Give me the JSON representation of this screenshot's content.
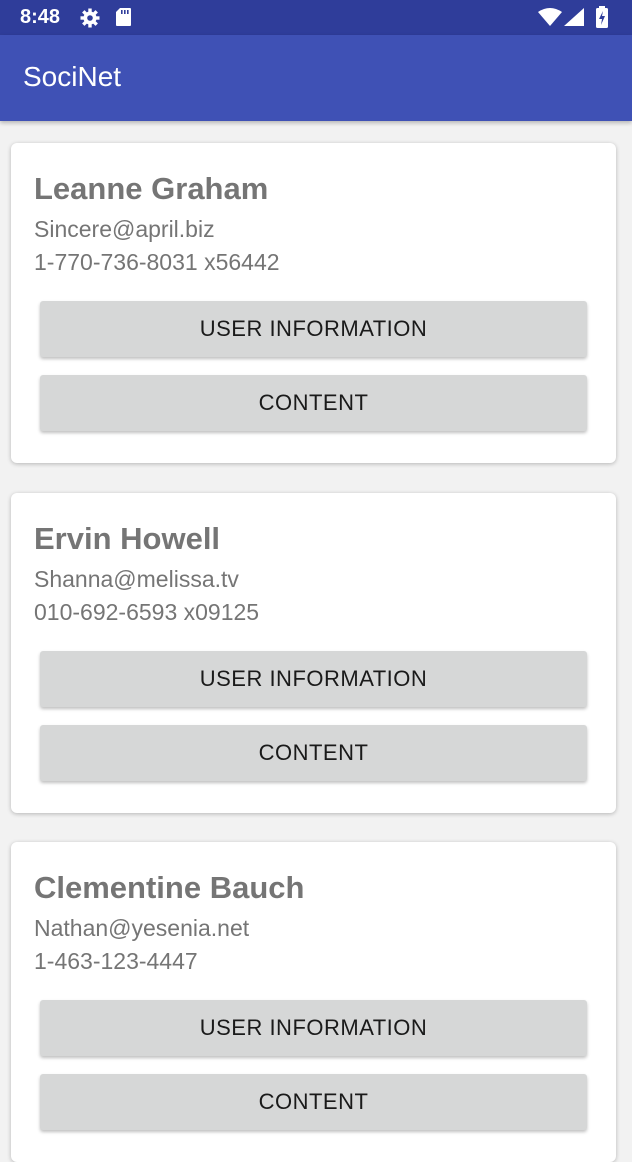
{
  "status_bar": {
    "time": "8:48",
    "icons": [
      "gear-icon",
      "sd-card-icon",
      "wifi-icon",
      "signal-icon",
      "battery-icon"
    ]
  },
  "app_bar": {
    "title": "SociNet"
  },
  "colors": {
    "status_bar": "#2f3d9a",
    "app_bar": "#3f51b5",
    "background": "#f2f2f2",
    "button": "#d6d7d7",
    "text_secondary": "#757575"
  },
  "users": [
    {
      "name": "Leanne Graham",
      "email": "Sincere@april.biz",
      "phone": "1-770-736-8031 x56442",
      "info_button": "USER INFORMATION",
      "content_button": "CONTENT"
    },
    {
      "name": "Ervin Howell",
      "email": "Shanna@melissa.tv",
      "phone": "010-692-6593 x09125",
      "info_button": "USER INFORMATION",
      "content_button": "CONTENT"
    },
    {
      "name": "Clementine Bauch",
      "email": "Nathan@yesenia.net",
      "phone": "1-463-123-4447",
      "info_button": "USER INFORMATION",
      "content_button": "CONTENT"
    }
  ]
}
